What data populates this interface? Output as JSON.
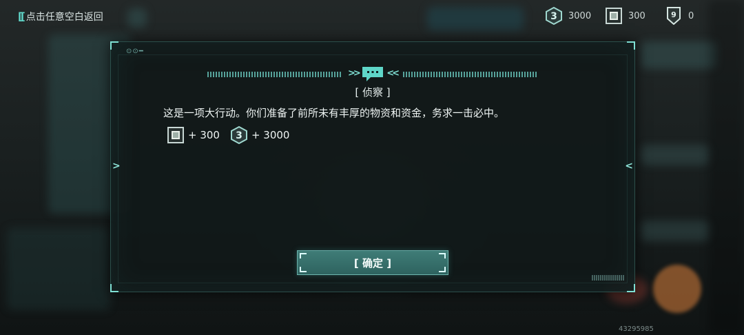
{
  "top_bar": {
    "back_label": "点击任意空白返回",
    "back_icon": "bracket-chevron-icon",
    "resources": [
      {
        "icon": "hex-coin-b-icon",
        "value": "3000"
      },
      {
        "icon": "chip-square-icon",
        "value": "300"
      },
      {
        "icon": "badge-tag-icon",
        "value": "0"
      }
    ]
  },
  "modal": {
    "title": "[ 侦察 ]",
    "description": "这是一项大行动。你们准备了前所未有丰厚的物资和资金，务求一击必中。",
    "rewards": [
      {
        "icon": "chip-square-icon",
        "amount": "+ 300"
      },
      {
        "icon": "hex-coin-b-icon",
        "amount": "+ 3000"
      }
    ],
    "confirm_label": "[ 确定 ]",
    "header_icon": "chat-bubble-icon"
  },
  "footer": {
    "build_id": "43295985"
  },
  "colors": {
    "accent": "#5fd6c8",
    "button": "#3a7470",
    "panel": "#111919"
  }
}
